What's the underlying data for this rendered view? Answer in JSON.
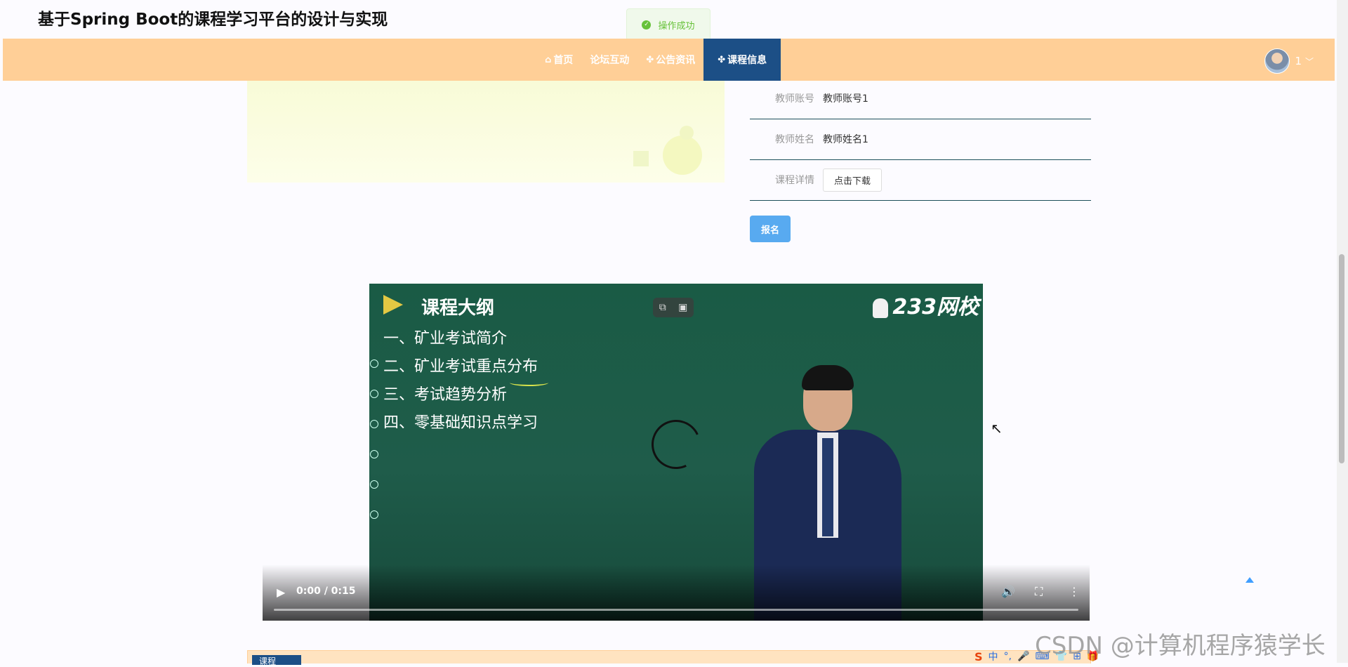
{
  "site": {
    "title": "基于Spring Boot的课程学习平台的设计与实现"
  },
  "toast": {
    "text": "操作成功"
  },
  "nav": {
    "items": [
      {
        "icon": "home-icon",
        "glyph": "⌂",
        "label": "首页"
      },
      {
        "icon": "",
        "glyph": "",
        "label": "论坛互动"
      },
      {
        "icon": "grid-icon",
        "glyph": "✤",
        "label": "公告资讯"
      },
      {
        "icon": "grid-icon",
        "glyph": "✤",
        "label": "课程信息",
        "active": true
      }
    ],
    "user": {
      "name": "1"
    }
  },
  "course": {
    "fields": [
      {
        "label": "教师账号",
        "value": "教师账号1"
      },
      {
        "label": "教师姓名",
        "value": "教师姓名1"
      },
      {
        "label": "课程详情",
        "value": "点击下载"
      }
    ],
    "signup_label": "报名"
  },
  "video": {
    "slide_title": "课程大纲",
    "outline": [
      "一、矿业考试简介",
      "二、矿业考试重点分布",
      "三、考试趋势分析",
      "四、零基础知识点学习"
    ],
    "logo": "233网校",
    "time": "0:00 / 0:15",
    "progress": 0
  },
  "bottom": {
    "tab_label": "课程"
  },
  "ime": {
    "items": [
      "S",
      "中",
      "°,",
      "🎤",
      "⌨",
      "👕",
      "⊞",
      "🎁"
    ]
  },
  "watermark": "CSDN @计算机程序猿学长",
  "colors": {
    "nav_bg": "#ffcf97",
    "nav_active": "#1c4f86",
    "signup_btn": "#58aaf0",
    "toast_green": "#67c23a"
  }
}
